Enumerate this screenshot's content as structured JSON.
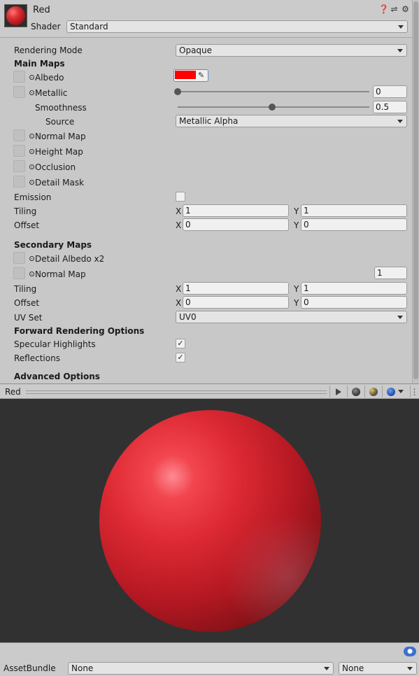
{
  "header": {
    "title": "Red",
    "shader_label": "Shader",
    "shader_value": "Standard",
    "icons": [
      "help-icon",
      "preset-icon",
      "settings-icon"
    ]
  },
  "rendering_mode": {
    "label": "Rendering Mode",
    "value": "Opaque"
  },
  "main_maps": {
    "heading": "Main Maps",
    "albedo": {
      "label": "Albedo",
      "color": "#ff0000"
    },
    "metallic": {
      "label": "Metallic",
      "value": "0",
      "level": 0
    },
    "smoothness": {
      "label": "Smoothness",
      "value": "0.5",
      "level": 0.5
    },
    "source": {
      "label": "Source",
      "value": "Metallic Alpha"
    },
    "normal_map": {
      "label": "Normal Map"
    },
    "height_map": {
      "label": "Height Map"
    },
    "occlusion": {
      "label": "Occlusion"
    },
    "detail_mask": {
      "label": "Detail Mask"
    },
    "emission": {
      "label": "Emission",
      "checked": false
    },
    "tiling": {
      "label": "Tiling",
      "x_label": "X",
      "x": "1",
      "y_label": "Y",
      "y": "1"
    },
    "offset": {
      "label": "Offset",
      "x_label": "X",
      "x": "0",
      "y_label": "Y",
      "y": "0"
    }
  },
  "secondary_maps": {
    "heading": "Secondary Maps",
    "detail_albedo": {
      "label": "Detail Albedo x2"
    },
    "normal_map": {
      "label": "Normal Map",
      "value": "1"
    },
    "tiling": {
      "label": "Tiling",
      "x_label": "X",
      "x": "1",
      "y_label": "Y",
      "y": "1"
    },
    "offset": {
      "label": "Offset",
      "x_label": "X",
      "x": "0",
      "y_label": "Y",
      "y": "0"
    },
    "uv_set": {
      "label": "UV Set",
      "value": "UV0"
    }
  },
  "forward_rendering": {
    "heading": "Forward Rendering Options",
    "specular_highlights": {
      "label": "Specular Highlights",
      "checked": true
    },
    "reflections": {
      "label": "Reflections",
      "checked": true
    }
  },
  "advanced": {
    "heading": "Advanced Options"
  },
  "preview": {
    "title": "Red",
    "buttons": [
      "play-icon",
      "sphere-mesh-icon",
      "light-icon",
      "preview-shape-dropdown-icon",
      "more-options-icon"
    ]
  },
  "footer": {
    "assetbundle_label": "AssetBundle",
    "bundle_name": "None",
    "bundle_variant": "None"
  }
}
